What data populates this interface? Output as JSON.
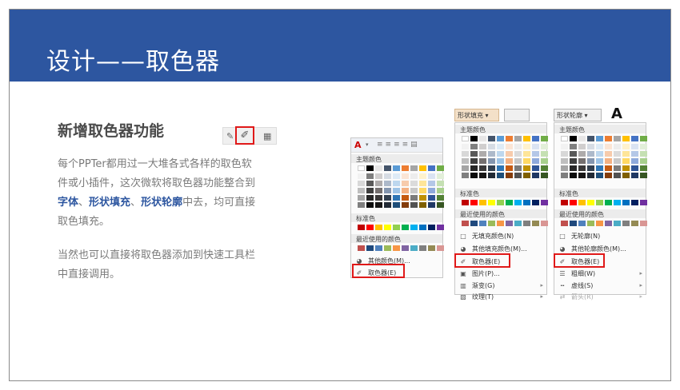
{
  "slide": {
    "title": "设计——取色器",
    "subtitle": "新增取色器功能",
    "para1": {
      "line1": "每个PPTer都用过一大堆各式各样的取色软",
      "line2": "件或小插件，这次微软将取色器功能整合到",
      "b1": "字体",
      "sep1": "、",
      "b2": "形状填充",
      "sep2": "、",
      "b3": "形状轮廓",
      "tail": "中去，均可直接",
      "line4": "取色填充。"
    },
    "para2": {
      "line1": "当然也可以直接将取色器添加到快速工具栏",
      "line2": "中直接调用。"
    }
  },
  "colors": {
    "header_bg": "#2d56a0",
    "highlight": "#e01919",
    "accent_text": "#2d56a0"
  },
  "menu_font": {
    "sec_theme": "主题颜色",
    "sec_standard": "标准色",
    "sec_recent": "最近使用的颜色",
    "more": "其他颜色(M)...",
    "picker": "取色器(E)"
  },
  "menu_fill": {
    "button": "形状填充 ▾",
    "sec_theme": "主题颜色",
    "sec_standard": "标准色",
    "sec_recent": "最近使用的颜色",
    "no_fill": "无填充颜色(N)",
    "more": "其他填充颜色(M)...",
    "picker": "取色器(E)",
    "picture": "图片(P)...",
    "gradient": "渐变(G)",
    "texture": "纹理(T)"
  },
  "menu_outline": {
    "button": "形状轮廓 ▾",
    "big_letter": "A",
    "sec_theme": "主题颜色",
    "sec_standard": "标准色",
    "sec_recent": "最近使用的颜色",
    "no_outline": "无轮廓(N)",
    "more": "其他轮廓颜色(M)...",
    "picker": "取色器(E)",
    "weight": "粗细(W)",
    "dashes": "虚线(S)",
    "arrows": "箭头(R)"
  }
}
